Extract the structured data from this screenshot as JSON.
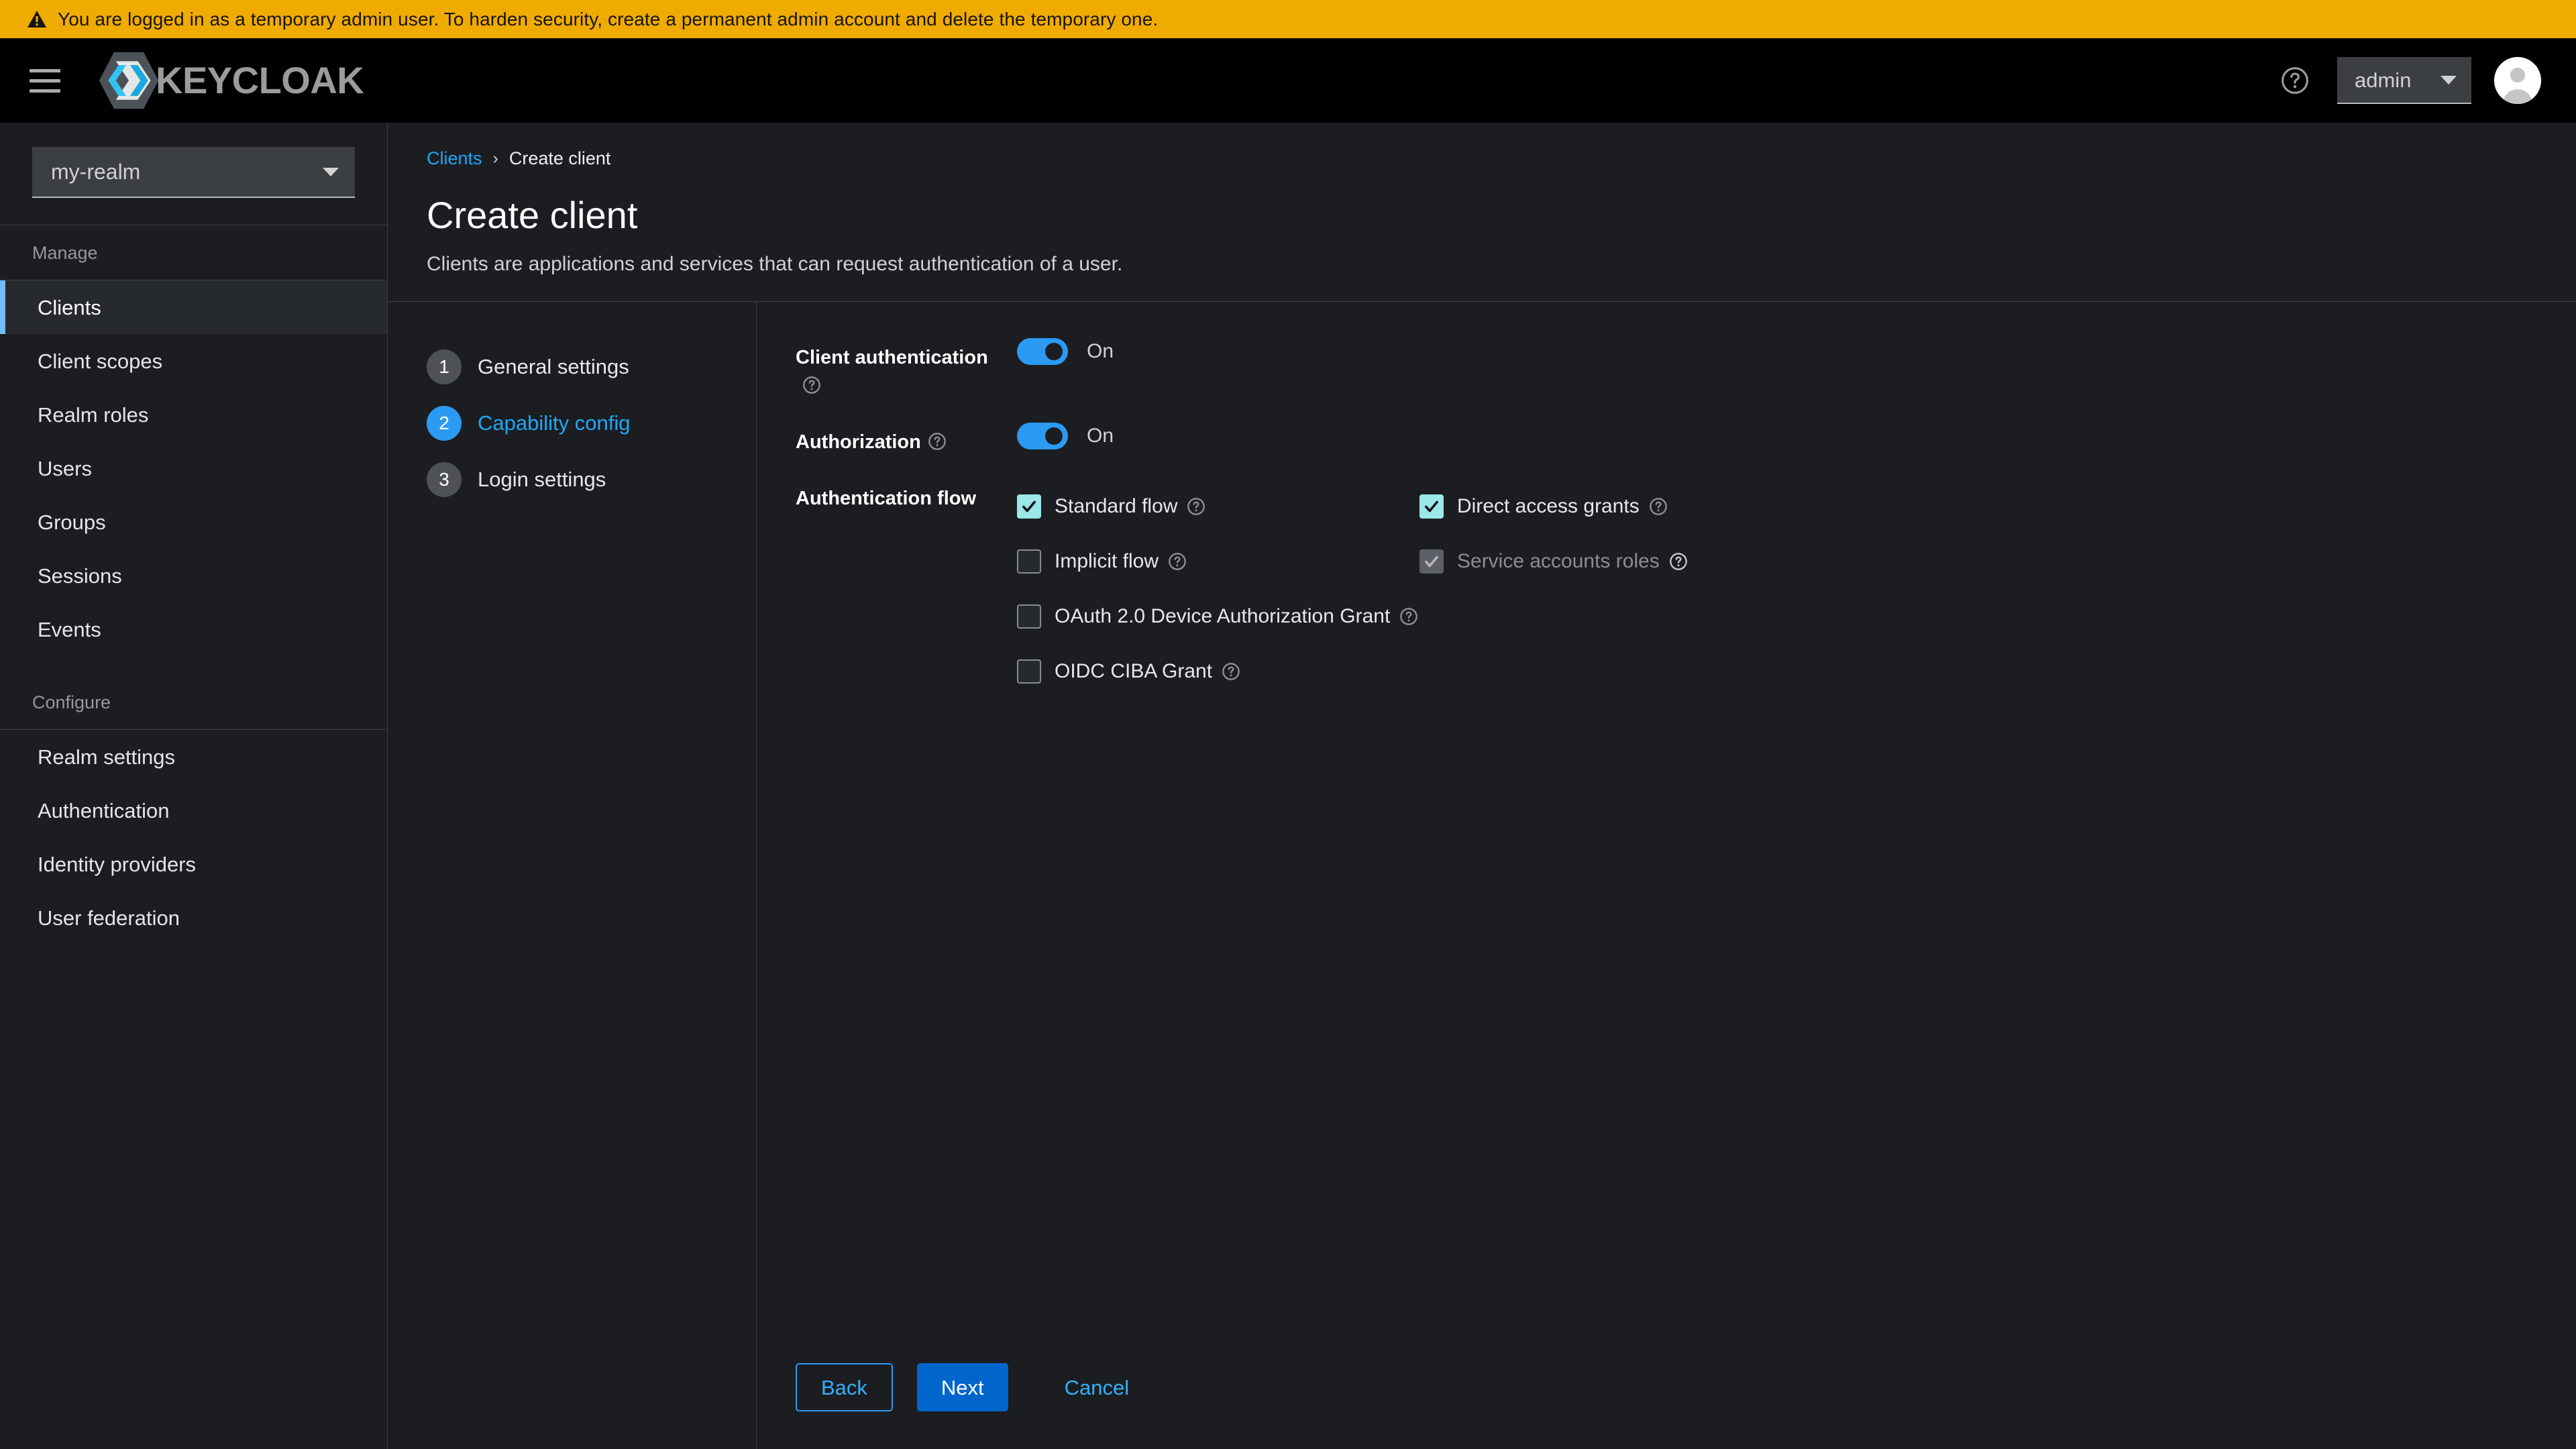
{
  "banner": {
    "icon": "warning-triangle-icon",
    "text": "You are logged in as a temporary admin user. To harden security, create a permanent admin account and delete the temporary one.",
    "background": "#f0ab00"
  },
  "masthead": {
    "toggle_nav_icon": "hamburger-icon",
    "brand_name": "KEYCLOAK",
    "help_icon": "help-circle-icon",
    "user_menu_label": "admin",
    "avatar_icon": "user-avatar-icon",
    "background": "#000000"
  },
  "sidebar": {
    "realm_selector": {
      "value": "my-realm",
      "caret_icon": "chevron-down-icon"
    },
    "groups": [
      {
        "title": "Manage",
        "items": [
          {
            "label": "Clients",
            "active": true
          },
          {
            "label": "Client scopes",
            "active": false
          },
          {
            "label": "Realm roles",
            "active": false
          },
          {
            "label": "Users",
            "active": false
          },
          {
            "label": "Groups",
            "active": false
          },
          {
            "label": "Sessions",
            "active": false
          },
          {
            "label": "Events",
            "active": false
          }
        ]
      },
      {
        "title": "Configure",
        "items": [
          {
            "label": "Realm settings",
            "active": false
          },
          {
            "label": "Authentication",
            "active": false
          },
          {
            "label": "Identity providers",
            "active": false
          },
          {
            "label": "User federation",
            "active": false
          }
        ]
      }
    ],
    "active_accent": "#73bcf7"
  },
  "page": {
    "breadcrumb": {
      "parent": "Clients",
      "separator": "›",
      "current": "Create client"
    },
    "title": "Create client",
    "subtitle": "Clients are applications and services that can request authentication of a user."
  },
  "wizard": {
    "steps": [
      {
        "number": "1",
        "label": "General settings",
        "active": false
      },
      {
        "number": "2",
        "label": "Capability config",
        "active": true
      },
      {
        "number": "3",
        "label": "Login settings",
        "active": false
      }
    ],
    "fields": {
      "client_authentication": {
        "label": "Client authentication",
        "hint_icon": "help-circle-icon",
        "value": "On",
        "checked": true
      },
      "authorization": {
        "label": "Authorization",
        "hint_icon": "help-circle-icon",
        "value": "On",
        "checked": true
      },
      "authentication_flow": {
        "label": "Authentication flow",
        "options": [
          {
            "label": "Standard flow",
            "checked": true,
            "disabled": false,
            "hint_icon": "help-circle-icon",
            "column": "left"
          },
          {
            "label": "Direct access grants",
            "checked": true,
            "disabled": false,
            "hint_icon": "help-circle-icon",
            "column": "right"
          },
          {
            "label": "Implicit flow",
            "checked": false,
            "disabled": false,
            "hint_icon": "help-circle-icon",
            "column": "left"
          },
          {
            "label": "Service accounts roles",
            "checked": true,
            "disabled": true,
            "hint_icon": "help-circle-icon",
            "column": "right"
          },
          {
            "label": "OAuth 2.0 Device Authorization Grant",
            "checked": false,
            "disabled": false,
            "hint_icon": "help-circle-icon",
            "column": "left"
          },
          {
            "label": "OIDC CIBA Grant",
            "checked": false,
            "disabled": false,
            "hint_icon": "help-circle-icon",
            "column": "left"
          }
        ]
      }
    },
    "footer": {
      "back_label": "Back",
      "next_label": "Next",
      "cancel_label": "Cancel"
    }
  },
  "colors": {
    "accent_blue": "#2b9af3",
    "link_blue": "#1fa7f8",
    "primary_button": "#0066cc",
    "checkbox_checked": "#9ce8e8",
    "page_background": "#1b1d21",
    "warning": "#f0ab00"
  }
}
